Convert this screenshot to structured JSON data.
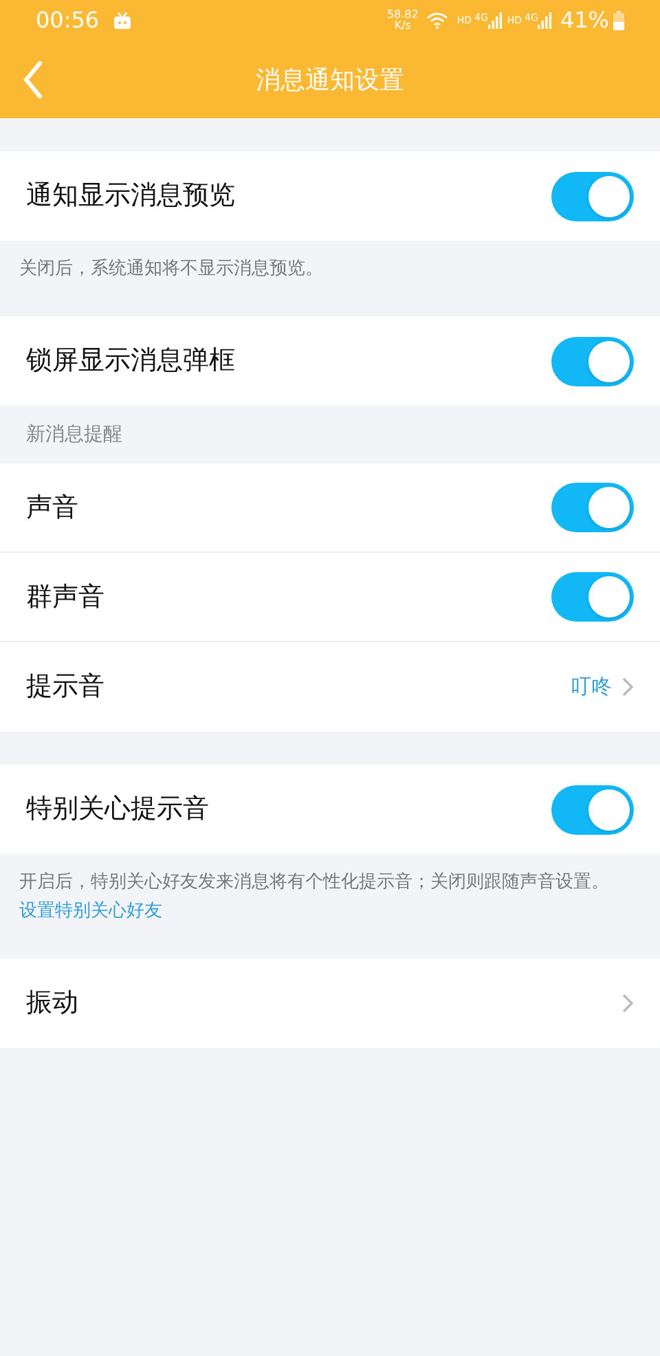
{
  "status_bar": {
    "time": "00:56",
    "speed": "58.82",
    "speed_unit": "K/s",
    "network_1": "HD",
    "gen_1": "4G",
    "network_2": "HD",
    "gen_2": "4G",
    "battery": "41%"
  },
  "header": {
    "title": "消息通知设置"
  },
  "blocks": [
    {
      "kind": "group",
      "rows": [
        {
          "kind": "toggle",
          "label": "通知显示消息预览",
          "on": true
        }
      ]
    },
    {
      "kind": "note",
      "text": "关闭后，系统通知将不显示消息预览。"
    },
    {
      "kind": "group",
      "rows": [
        {
          "kind": "toggle",
          "label": "锁屏显示消息弹框",
          "on": true
        }
      ]
    },
    {
      "kind": "section",
      "text": "新消息提醒"
    },
    {
      "kind": "group",
      "rows": [
        {
          "kind": "toggle",
          "label": "声音",
          "on": true
        },
        {
          "kind": "toggle",
          "label": "群声音",
          "on": true
        },
        {
          "kind": "link",
          "label": "提示音",
          "value": "叮咚"
        }
      ]
    },
    {
      "kind": "group",
      "rows": [
        {
          "kind": "toggle",
          "label": "特别关心提示音",
          "on": true
        }
      ]
    },
    {
      "kind": "note",
      "text": "开启后，特别关心好友发来消息将有个性化提示音；关闭则跟随声音设置。",
      "link": "设置特别关心好友"
    },
    {
      "kind": "group",
      "rows": [
        {
          "kind": "link",
          "label": "振动"
        }
      ]
    }
  ]
}
